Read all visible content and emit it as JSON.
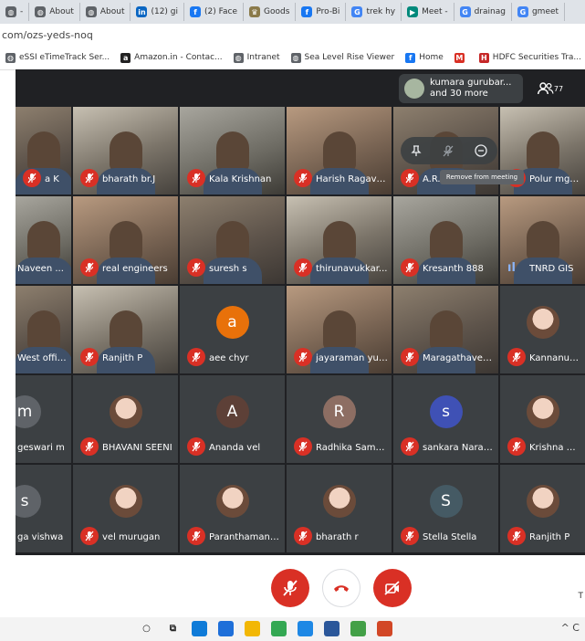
{
  "browser": {
    "tabs": [
      {
        "label": "-",
        "icon": "generic-icon",
        "color": "#5f6368"
      },
      {
        "label": "About",
        "icon": "generic-icon",
        "color": "#5f6368"
      },
      {
        "label": "About",
        "icon": "generic-icon",
        "color": "#5f6368"
      },
      {
        "label": "(12) gi",
        "icon": "linkedin-icon",
        "color": "#0a66c2"
      },
      {
        "label": "(2) Face",
        "icon": "facebook-icon",
        "color": "#1877f2"
      },
      {
        "label": "Goods",
        "icon": "emblem-icon",
        "color": "#8a7a4a"
      },
      {
        "label": "Pro-Bi",
        "icon": "facebook-icon",
        "color": "#1877f2"
      },
      {
        "label": "trek hy",
        "icon": "google-icon",
        "color": "#4285f4"
      },
      {
        "label": "Meet -",
        "icon": "meet-icon",
        "color": "#00897b"
      },
      {
        "label": "drainag",
        "icon": "google-icon",
        "color": "#4285f4"
      },
      {
        "label": "gmeet",
        "icon": "google-icon",
        "color": "#4285f4"
      }
    ],
    "url": "com/ozs-yeds-noq",
    "bookmarks": [
      {
        "label": "eSSI eTimeTrack Ser...",
        "icon": "globe-icon",
        "color": "#5f6368"
      },
      {
        "label": "Amazon.in - Contac...",
        "icon": "amazon-icon",
        "color": "#222222"
      },
      {
        "label": "Intranet",
        "icon": "globe-icon",
        "color": "#5f6368"
      },
      {
        "label": "Sea Level Rise Viewer",
        "icon": "globe-icon",
        "color": "#5f6368"
      },
      {
        "label": "Home",
        "icon": "facebook-icon",
        "color": "#1877f2"
      },
      {
        "label": "",
        "icon": "gmail-icon",
        "color": "#d93025"
      },
      {
        "label": "HDFC Securities Tra...",
        "icon": "hdfc-icon",
        "color": "#c62828"
      }
    ]
  },
  "meet": {
    "participants_pill": {
      "line1": "kumara gurubar...",
      "line2": "and 30 more"
    },
    "people_count": "77",
    "hover_tooltip": "Remove from meeting",
    "tiles": [
      {
        "name": "a K",
        "kind": "video",
        "muted": true
      },
      {
        "name": "bharath br.J",
        "kind": "video",
        "muted": true
      },
      {
        "name": "Kala Krishnan",
        "kind": "video",
        "muted": true
      },
      {
        "name": "Harish Ragave...",
        "kind": "video",
        "muted": true
      },
      {
        "name": "A.R...",
        "kind": "video",
        "muted": true
      },
      {
        "name": "Polur mgnre",
        "kind": "video",
        "muted": true
      },
      {
        "name": "Naveen ...",
        "kind": "video",
        "muted": false
      },
      {
        "name": "real engineers",
        "kind": "video",
        "muted": true
      },
      {
        "name": "suresh s",
        "kind": "video",
        "muted": true
      },
      {
        "name": "thirunavukkar...",
        "kind": "video",
        "muted": true
      },
      {
        "name": "Kresanth 888",
        "kind": "video",
        "muted": true
      },
      {
        "name": "TNRD GIS",
        "kind": "video",
        "muted": false,
        "speaking": true
      },
      {
        "name": "West office",
        "kind": "video",
        "muted": false
      },
      {
        "name": "Ranjith P",
        "kind": "video",
        "muted": true
      },
      {
        "name": "aee chyr",
        "kind": "avatar",
        "letter": "a",
        "color": "#e8710a",
        "muted": true
      },
      {
        "name": "jayaraman yuv...",
        "kind": "video",
        "muted": true
      },
      {
        "name": "Maragathaven...",
        "kind": "video",
        "muted": true
      },
      {
        "name": "Kannanunni",
        "kind": "photo",
        "muted": true
      },
      {
        "name": "geswari m",
        "kind": "avatar",
        "letter": "m",
        "color": "#5f6368",
        "muted": false
      },
      {
        "name": "BHAVANI SEENI",
        "kind": "photo",
        "muted": true
      },
      {
        "name": "Ananda vel",
        "kind": "avatar",
        "letter": "A",
        "color": "#5d4037",
        "muted": true
      },
      {
        "name": "Radhika Samp...",
        "kind": "avatar",
        "letter": "R",
        "color": "#8d6e63",
        "muted": true
      },
      {
        "name": "sankara Naray...",
        "kind": "avatar",
        "letter": "s",
        "color": "#3f51b5",
        "muted": true
      },
      {
        "name": "Krishna Kris",
        "kind": "photo",
        "muted": true
      },
      {
        "name": "ga vishwa",
        "kind": "avatar",
        "letter": "s",
        "color": "#5f6368",
        "muted": false
      },
      {
        "name": "vel murugan",
        "kind": "photo",
        "muted": true
      },
      {
        "name": "Paranthaman ...",
        "kind": "photo",
        "muted": true
      },
      {
        "name": "bharath r",
        "kind": "photo",
        "muted": true
      },
      {
        "name": "Stella Stella",
        "kind": "avatar",
        "letter": "S",
        "color": "#455a64",
        "muted": true
      },
      {
        "name": "Ranjith P",
        "kind": "photo",
        "muted": true
      }
    ],
    "bottom_right_letter": "T"
  },
  "taskbar": {
    "apps": [
      {
        "icon": "search-circle-icon",
        "color": "#ffffff"
      },
      {
        "icon": "task-view-icon",
        "color": "#ffffff"
      },
      {
        "icon": "edge-icon",
        "color": "#0f7bd8"
      },
      {
        "icon": "mail-icon",
        "color": "#1e6fd9"
      },
      {
        "icon": "file-explorer-icon",
        "color": "#f2b705"
      },
      {
        "icon": "chrome-icon",
        "color": "#34a853"
      },
      {
        "icon": "store-icon",
        "color": "#1e88e5"
      },
      {
        "icon": "word-icon",
        "color": "#2b579a"
      },
      {
        "icon": "paint-icon",
        "color": "#43a047"
      },
      {
        "icon": "powerpoint-icon",
        "color": "#d24726"
      }
    ],
    "tray": "^ C"
  }
}
